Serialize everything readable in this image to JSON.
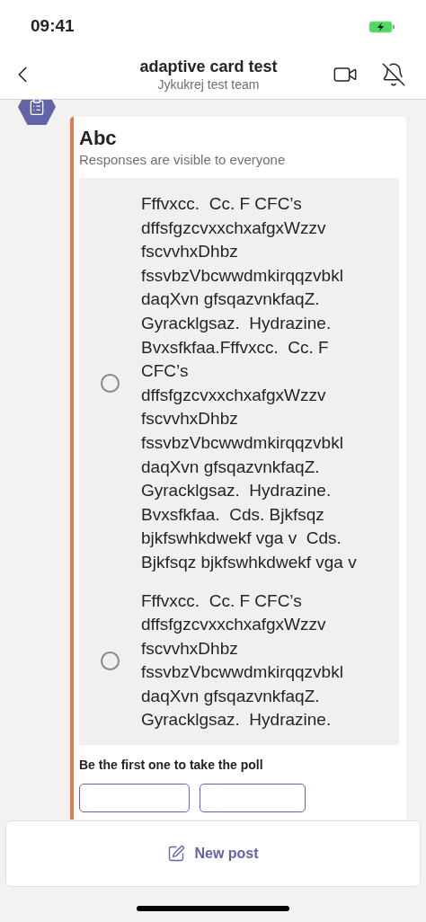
{
  "status_bar": {
    "time": "09:41"
  },
  "header": {
    "title": "adaptive card test",
    "subtitle": "Jykukrej test team"
  },
  "poll": {
    "title": "Abc",
    "subtitle": "Responses are visible to everyone",
    "options": [
      {
        "text": "Fffvxcc.  Cc. F CFC’s dffsfgzcvxxchxafgxWzzv fscvvhxDhbz fssvbzVbcwwdmkirqqzvbkl daqXvn gfsqazvnkfaqZ. Gyracklgsaz.  Hydrazine. Bvxsfkfaa.Fffvxcc.  Cc. F CFC’s dffsfgzcvxxchxafgxWzzv fscvvhxDhbz fssvbzVbcwwdmkirqqzvbkl daqXvn gfsqazvnkfaqZ. Gyracklgsaz.  Hydrazine. Bvxsfkfaa.  Cds. Bjkfsqz bjkfswhkdwekf vga v  Cds. Bjkfsqz bjkfswhkdwekf vga v",
        "selected": false
      },
      {
        "text": "Fffvxcc.  Cc. F CFC’s dffsfgzcvxxchxafgxWzzv fscvvhxDhbz fssvbzVbcwwdmkirqqzvbkl daqXvn gfsqazvnkfaqZ. Gyracklgsaz.  Hydrazine.",
        "selected": false
      }
    ],
    "footer": "Be the first one to take the poll"
  },
  "new_post": {
    "label": "New post"
  }
}
